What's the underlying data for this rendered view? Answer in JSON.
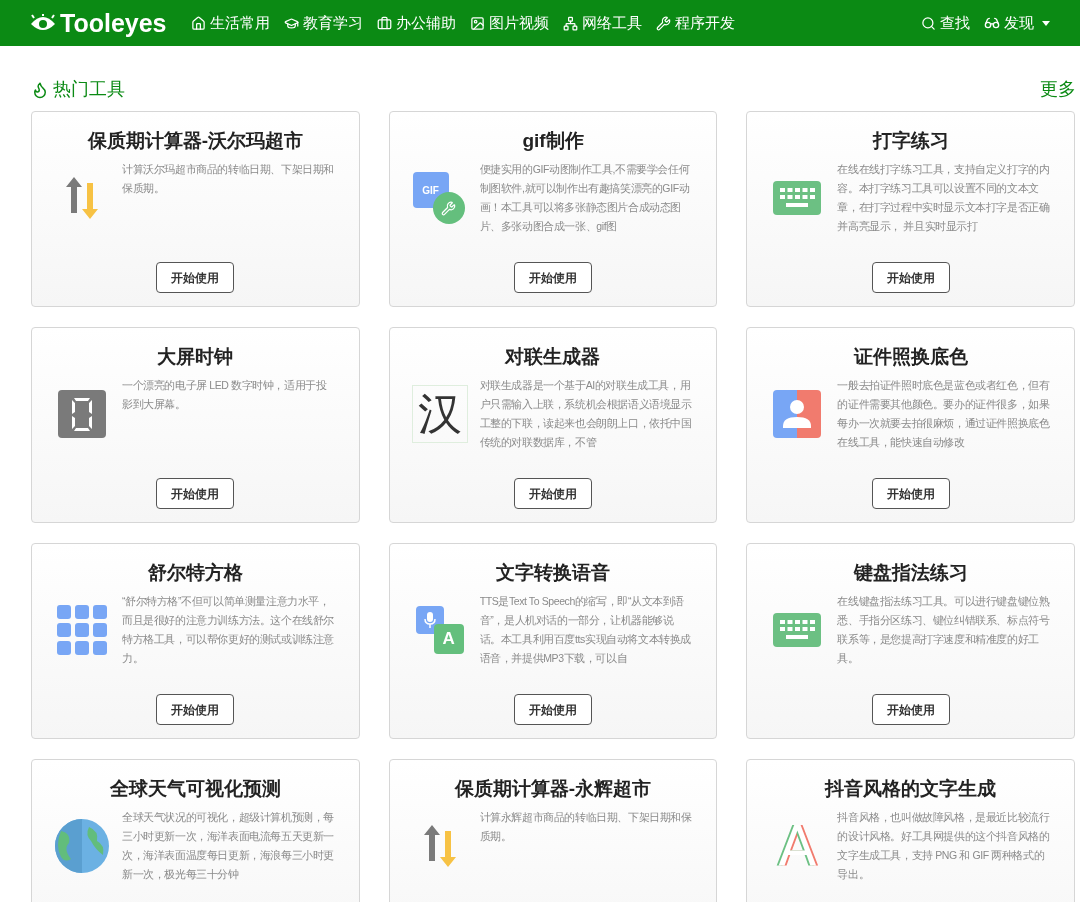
{
  "header": {
    "logo": "Tooleyes",
    "nav": [
      {
        "label": "生活常用",
        "kind": "home"
      },
      {
        "label": "教育学习",
        "kind": "cap"
      },
      {
        "label": "办公辅助",
        "kind": "briefcase"
      },
      {
        "label": "图片视频",
        "kind": "image"
      },
      {
        "label": "网络工具",
        "kind": "network"
      },
      {
        "label": "程序开发",
        "kind": "wrench"
      }
    ],
    "search": "查找",
    "discover": "发现"
  },
  "section": {
    "title": "热门工具",
    "more": "更多"
  },
  "cards": [
    {
      "title": "保质期计算器-沃尔玛超市",
      "kind": "arrows",
      "desc": "计算沃尔玛超市商品的转临日期、下架日期和保质期。",
      "button": "开始使用"
    },
    {
      "title": "gif制作",
      "kind": "gif",
      "icon_text": "GIF",
      "desc": "便捷实用的GIF动图制作工具,不需要学会任何制图软件,就可以制作出有趣搞笑漂亮的GIF动画！本工具可以将多张静态图片合成动态图片、多张动图合成一张、gif图",
      "button": "开始使用"
    },
    {
      "title": "打字练习",
      "kind": "keyboard",
      "desc": "在线在线打字练习工具，支持自定义打字的内容。本打字练习工具可以设置不同的文本文章，在打字过程中实时显示文本打字是否正确并高亮显示， 并且实时显示打",
      "button": "开始使用"
    },
    {
      "title": "大屏时钟",
      "kind": "segment",
      "desc": "一个漂亮的电子屏 LED 数字时钟，适用于投影到大屏幕。",
      "button": "开始使用"
    },
    {
      "title": "对联生成器",
      "kind": "han",
      "icon_text": "汉",
      "desc": "对联生成器是一个基于AI的对联生成工具，用户只需输入上联，系统机会根据语义语境显示工整的下联，读起来也会朗朗上口，依托中国传统的对联数据库，不管",
      "button": "开始使用"
    },
    {
      "title": "证件照换底色",
      "kind": "idphoto",
      "desc": "一般去拍证件照时底色是蓝色或者红色，但有的证件需要其他颜色。要办的证件很多，如果每办一次就要去拍很麻烦，通过证件照换底色在线工具，能快速自动修改",
      "button": "开始使用"
    },
    {
      "title": "舒尔特方格",
      "kind": "grid",
      "desc": "“舒尔特方格”不但可以简单测量注意力水平，而且是很好的注意力训练方法。这个在线舒尔特方格工具，可以帮你更好的测试或训练注意力。",
      "button": "开始使用"
    },
    {
      "title": "文字转换语音",
      "kind": "tts",
      "icon_text": "A",
      "desc": "TTS是Text To Speech的缩写，即“从文本到语音”，是人机对话的一部分，让机器能够说话。本工具利用百度tts实现自动将文本转换成语音，并提供MP3下载，可以自",
      "button": "开始使用"
    },
    {
      "title": "键盘指法练习",
      "kind": "keyboard",
      "desc": "在线键盘指法练习工具。可以进行键盘键位熟悉、手指分区练习、键位纠错联系、标点符号联系等，是您提高打字速度和精准度的好工具。",
      "button": "开始使用"
    },
    {
      "title": "全球天气可视化预测",
      "kind": "globe",
      "desc": "全球天气状况的可视化，超级计算机预测，每三小时更新一次，海洋表面电流每五天更新一次，海洋表面温度每日更新，海浪每三小时更新一次，极光每三十分钟"
    },
    {
      "title": "保质期计算器-永辉超市",
      "kind": "arrows",
      "desc": "计算永辉超市商品的转临日期、下架日期和保质期。"
    },
    {
      "title": "抖音风格的文字生成",
      "kind": "glitch",
      "icon_text": "A",
      "desc": "抖音风格，也叫做故障风格，是最近比较流行的设计风格。好工具网提供的这个抖音风格的文字生成工具，支持 PNG 和 GIF 两种格式的导出。"
    }
  ]
}
